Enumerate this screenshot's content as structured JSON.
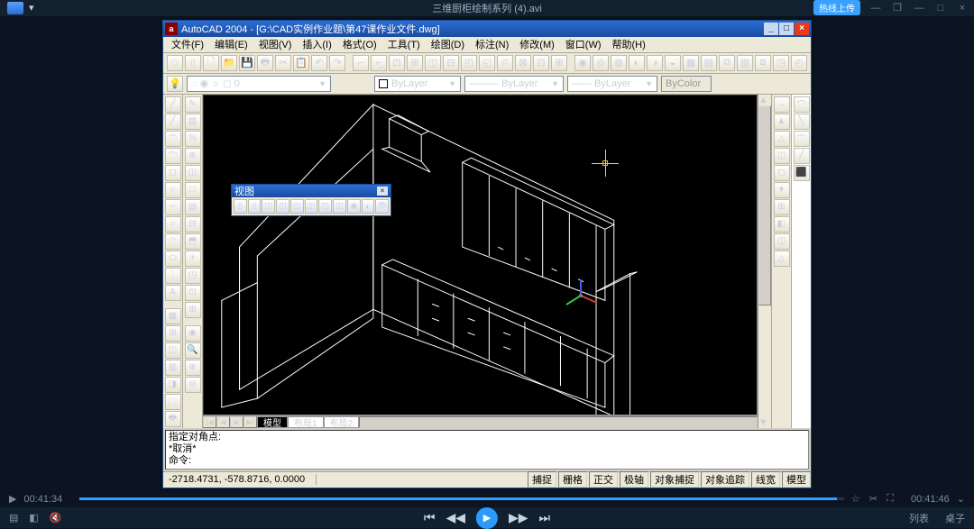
{
  "player": {
    "title": "三维厨柜绘制系列 (4).avi",
    "badge": "热线上传",
    "win_min": "—",
    "win_rest": "❐",
    "win_min2": "—",
    "win_max": "□",
    "win_close": "×",
    "time_cur": "00:41:34",
    "time_total": "00:41:46",
    "bottom_L1": "▤",
    "bottom_L2": "◧",
    "bottom_L3": "🔇",
    "bottom_C_prevfile": "⏮",
    "bottom_C_prev": "◀◀",
    "bottom_C_play": "▶",
    "bottom_C_next": "▶▶",
    "bottom_C_nextfile": "⏭",
    "bottom_R1": "列表",
    "bottom_R2": "桌子",
    "tool_fav": "☆",
    "tool_cut": "✂",
    "tool_full": "⛶"
  },
  "acad": {
    "app_icon": "a",
    "title": "AutoCAD 2004 - [G:\\CAD实例作业题\\第47课作业文件.dwg]",
    "min": "_",
    "max": "□",
    "close": "×",
    "menu": [
      "文件(F)",
      "编辑(E)",
      "视图(V)",
      "插入(I)",
      "格式(O)",
      "工具(T)",
      "绘图(D)",
      "标注(N)",
      "修改(M)",
      "窗口(W)",
      "帮助(H)"
    ],
    "toolbar1": [
      "□",
      "▯",
      "🗋",
      "📁",
      "💾",
      "🖶",
      "✂",
      "📋",
      "↶",
      "↷",
      "",
      "⌐",
      "⌐̲",
      "⊡",
      "⊞",
      "◫",
      "⊟",
      "◰",
      "◱",
      "⌑",
      "⊠",
      "⊡",
      "⊞",
      "",
      "◉",
      "◎",
      "◍",
      "◐",
      "◑",
      "◒",
      "▦",
      "▤",
      "⧉",
      "▥",
      "⧈",
      "◳",
      "◴"
    ],
    "layer_icon": "💡",
    "layer_combo": "◌ ◉ ☼ ◻ 0",
    "prop_combo1": "ByLayer",
    "prop_combo2": "——— ByLayer",
    "prop_combo3": "—— ByLayer",
    "prop_disabled": "ByColor",
    "left_tools": [
      "╱",
      "╱",
      "⌒",
      "⌒",
      "◻",
      "○",
      "~",
      "○",
      "◠",
      "⬭",
      "⋮",
      "A",
      "",
      "▦",
      "⊞",
      "◫",
      "▥",
      "◨",
      "⬚",
      "🖶"
    ],
    "left_tools2": [
      "✎",
      "▨",
      "%",
      "⊕",
      "◫",
      "□",
      "▤",
      "⊟",
      "⬒",
      "+",
      "◳",
      "⊡",
      "⊞",
      "",
      "◉",
      "🔍",
      "⊕",
      "⊖"
    ],
    "right_tools": [
      "↔",
      "▲",
      "△",
      "◫",
      "◻",
      "✦",
      "⊞",
      "◧",
      "◫",
      "△"
    ],
    "right_tools2": [
      "⌒",
      "╲",
      "⌒",
      "╱",
      "⬛"
    ],
    "float_title": "视图",
    "float_x": "×",
    "float_icons": [
      "▯",
      "▯",
      "◫",
      "◫",
      "◫",
      "◫",
      "◫",
      "◫",
      "◉",
      "◐",
      "👁"
    ],
    "tab_nav": [
      "|◀",
      "◀",
      "▶",
      "▶|"
    ],
    "tabs": [
      "模型",
      "布局1",
      "布局2"
    ],
    "cmd1": "指定对角点:",
    "cmd2": "*取消*",
    "cmd_prompt": "命令:",
    "coords": "-2718.4731, -578.8716, 0.0000",
    "snaps": [
      "捕捉",
      "栅格",
      "正交",
      "极轴",
      "对象捕捉",
      "对象追踪",
      "线宽",
      "模型"
    ]
  }
}
